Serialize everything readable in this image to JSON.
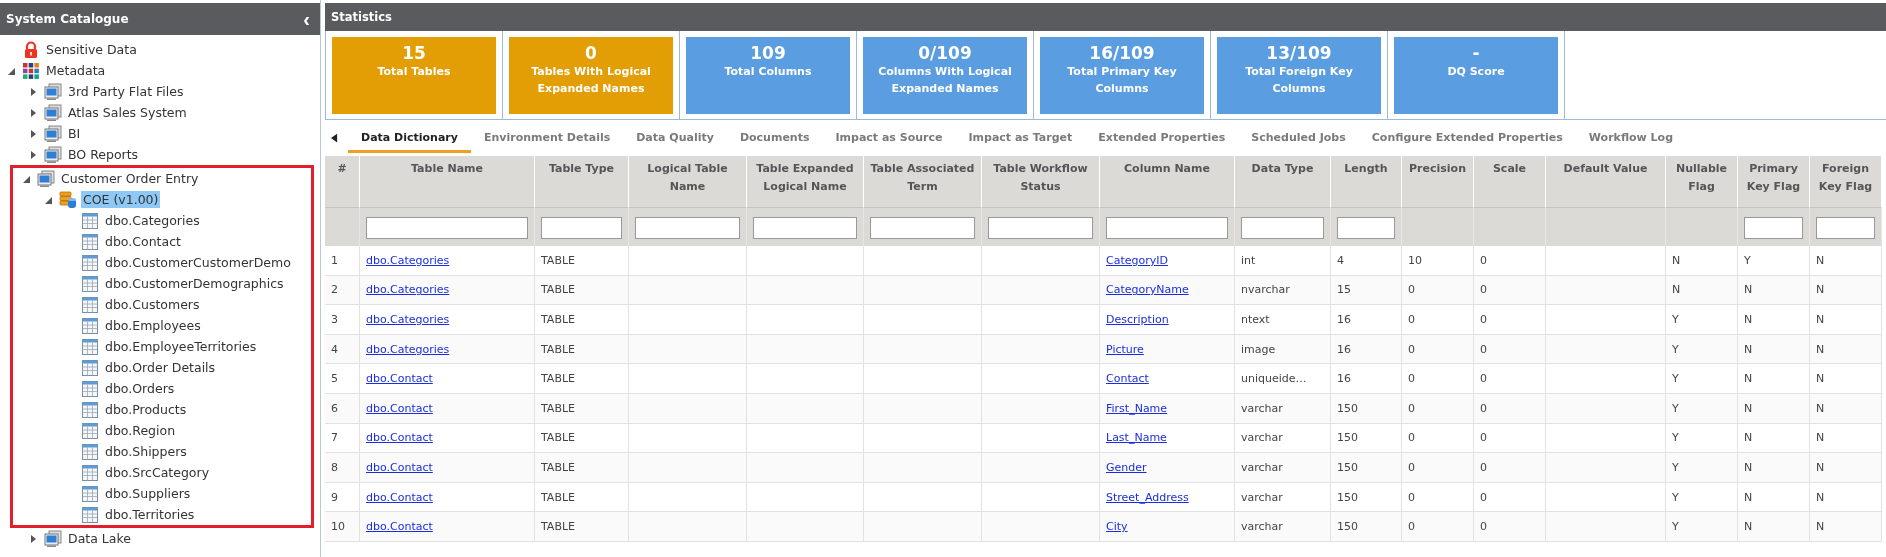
{
  "sidebar": {
    "title": "System Catalogue",
    "collapse_icon": "‹",
    "tree": [
      {
        "label": "Sensitive Data",
        "kind": "lock"
      },
      {
        "label": "Metadata",
        "kind": "grid",
        "expanded": true,
        "children": [
          {
            "label": "3rd Party Flat Files",
            "kind": "server",
            "expanded": false,
            "highlighted": false
          },
          {
            "label": "Atlas Sales System",
            "kind": "server",
            "expanded": false,
            "highlighted": false
          },
          {
            "label": "BI",
            "kind": "server",
            "expanded": false,
            "highlighted": false
          },
          {
            "label": "BO Reports",
            "kind": "server",
            "expanded": false,
            "highlighted": false
          },
          {
            "label": "Customer Order Entry",
            "kind": "server",
            "expanded": true,
            "highlighted": true,
            "children": [
              {
                "label": "COE (v1.00)",
                "kind": "database",
                "expanded": true,
                "selected": true,
                "children": [
                  {
                    "label": "dbo.Categories",
                    "kind": "table",
                    "selected": false
                  },
                  {
                    "label": "dbo.Contact",
                    "kind": "table",
                    "selected": false
                  },
                  {
                    "label": "dbo.CustomerCustomerDemo",
                    "kind": "table",
                    "selected": false
                  },
                  {
                    "label": "dbo.CustomerDemographics",
                    "kind": "table",
                    "selected": false
                  },
                  {
                    "label": "dbo.Customers",
                    "kind": "table",
                    "selected": false
                  },
                  {
                    "label": "dbo.Employees",
                    "kind": "table",
                    "selected": false
                  },
                  {
                    "label": "dbo.EmployeeTerritories",
                    "kind": "table",
                    "selected": false
                  },
                  {
                    "label": "dbo.Order Details",
                    "kind": "table",
                    "selected": false
                  },
                  {
                    "label": "dbo.Orders",
                    "kind": "table",
                    "selected": false
                  },
                  {
                    "label": "dbo.Products",
                    "kind": "table",
                    "selected": false
                  },
                  {
                    "label": "dbo.Region",
                    "kind": "table",
                    "selected": false
                  },
                  {
                    "label": "dbo.Shippers",
                    "kind": "table",
                    "selected": false
                  },
                  {
                    "label": "dbo.SrcCategory",
                    "kind": "table",
                    "selected": false
                  },
                  {
                    "label": "dbo.Suppliers",
                    "kind": "table",
                    "selected": false
                  },
                  {
                    "label": "dbo.Territories",
                    "kind": "table",
                    "selected": false
                  }
                ]
              }
            ]
          },
          {
            "label": "Data Lake",
            "kind": "server",
            "expanded": false,
            "highlighted": false
          }
        ]
      }
    ]
  },
  "statistics": {
    "title": "Statistics",
    "cards": [
      {
        "value": "15",
        "label": "Total Tables",
        "color": "#e39e06"
      },
      {
        "value": "0",
        "label": "Tables With Logical Expanded Names",
        "color": "#e39e06"
      },
      {
        "value": "109",
        "label": "Total Columns",
        "color": "#5a9de0"
      },
      {
        "value": "0/109",
        "label": "Columns With Logical Expanded Names",
        "color": "#5a9de0"
      },
      {
        "value": "16/109",
        "label": "Total Primary Key Columns",
        "color": "#5a9de0"
      },
      {
        "value": "13/109",
        "label": "Total Foreign Key Columns",
        "color": "#5a9de0"
      },
      {
        "value": "-",
        "label": "DQ Score",
        "color": "#5a9de0"
      }
    ]
  },
  "tabs": [
    {
      "label": "Data Dictionary",
      "selected": true
    },
    {
      "label": "Environment Details",
      "selected": false
    },
    {
      "label": "Data Quality",
      "selected": false
    },
    {
      "label": "Documents",
      "selected": false
    },
    {
      "label": "Impact as Source",
      "selected": false
    },
    {
      "label": "Impact as Target",
      "selected": false
    },
    {
      "label": "Extended Properties",
      "selected": false
    },
    {
      "label": "Scheduled Jobs",
      "selected": false
    },
    {
      "label": "Configure Extended Properties",
      "selected": false
    },
    {
      "label": "Workflow Log",
      "selected": false
    }
  ],
  "table": {
    "columns": [
      {
        "label": "#",
        "filter": false,
        "link": false
      },
      {
        "label": "Table Name",
        "filter": true,
        "link": true
      },
      {
        "label": "Table Type",
        "filter": true,
        "link": false
      },
      {
        "label": "Logical Table Name",
        "filter": true
      },
      {
        "label": "Table Expanded Logical Name",
        "filter": true
      },
      {
        "label": "Table Associated Term",
        "filter": true
      },
      {
        "label": "Table Workflow Status",
        "filter": true
      },
      {
        "label": "Column Name",
        "filter": true,
        "link": true
      },
      {
        "label": "Data Type",
        "filter": true,
        "link": false
      },
      {
        "label": "Length",
        "filter": true,
        "link": false
      },
      {
        "label": "Precision",
        "filter": false,
        "link": false
      },
      {
        "label": "Scale",
        "filter": false,
        "link": false
      },
      {
        "label": "Default Value",
        "filter": false
      },
      {
        "label": "Nullable Flag",
        "filter": false,
        "link": false
      },
      {
        "label": "Primary Key Flag",
        "filter": true,
        "link": false
      },
      {
        "label": "Foreign Key Flag",
        "filter": true,
        "link": false
      }
    ],
    "rows": [
      [
        "1",
        "dbo.Categories",
        "TABLE",
        null,
        null,
        null,
        null,
        "CategoryID",
        "int",
        "4",
        "10",
        "0",
        null,
        "N",
        "Y",
        "N"
      ],
      [
        "2",
        "dbo.Categories",
        "TABLE",
        null,
        null,
        null,
        null,
        "CategoryName",
        "nvarchar",
        "15",
        "0",
        "0",
        null,
        "N",
        "N",
        "N"
      ],
      [
        "3",
        "dbo.Categories",
        "TABLE",
        null,
        null,
        null,
        null,
        "Description",
        "ntext",
        "16",
        "0",
        "0",
        null,
        "Y",
        "N",
        "N"
      ],
      [
        "4",
        "dbo.Categories",
        "TABLE",
        null,
        null,
        null,
        null,
        "Picture",
        "image",
        "16",
        "0",
        "0",
        null,
        "Y",
        "N",
        "N"
      ],
      [
        "5",
        "dbo.Contact",
        "TABLE",
        null,
        null,
        null,
        null,
        "Contact",
        "uniqueide…",
        "16",
        "0",
        "0",
        null,
        "Y",
        "N",
        "N"
      ],
      [
        "6",
        "dbo.Contact",
        "TABLE",
        null,
        null,
        null,
        null,
        "First_Name",
        "varchar",
        "150",
        "0",
        "0",
        null,
        "Y",
        "N",
        "N"
      ],
      [
        "7",
        "dbo.Contact",
        "TABLE",
        null,
        null,
        null,
        null,
        "Last_Name",
        "varchar",
        "150",
        "0",
        "0",
        null,
        "Y",
        "N",
        "N"
      ],
      [
        "8",
        "dbo.Contact",
        "TABLE",
        null,
        null,
        null,
        null,
        "Gender",
        "varchar",
        "150",
        "0",
        "0",
        null,
        "Y",
        "N",
        "N"
      ],
      [
        "9",
        "dbo.Contact",
        "TABLE",
        null,
        null,
        null,
        null,
        "Street_Address",
        "varchar",
        "150",
        "0",
        "0",
        null,
        "Y",
        "N",
        "N"
      ],
      [
        "10",
        "dbo.Contact",
        "TABLE",
        null,
        null,
        null,
        null,
        "City",
        "varchar",
        "150",
        "0",
        "0",
        null,
        "Y",
        "N",
        "N"
      ]
    ]
  }
}
